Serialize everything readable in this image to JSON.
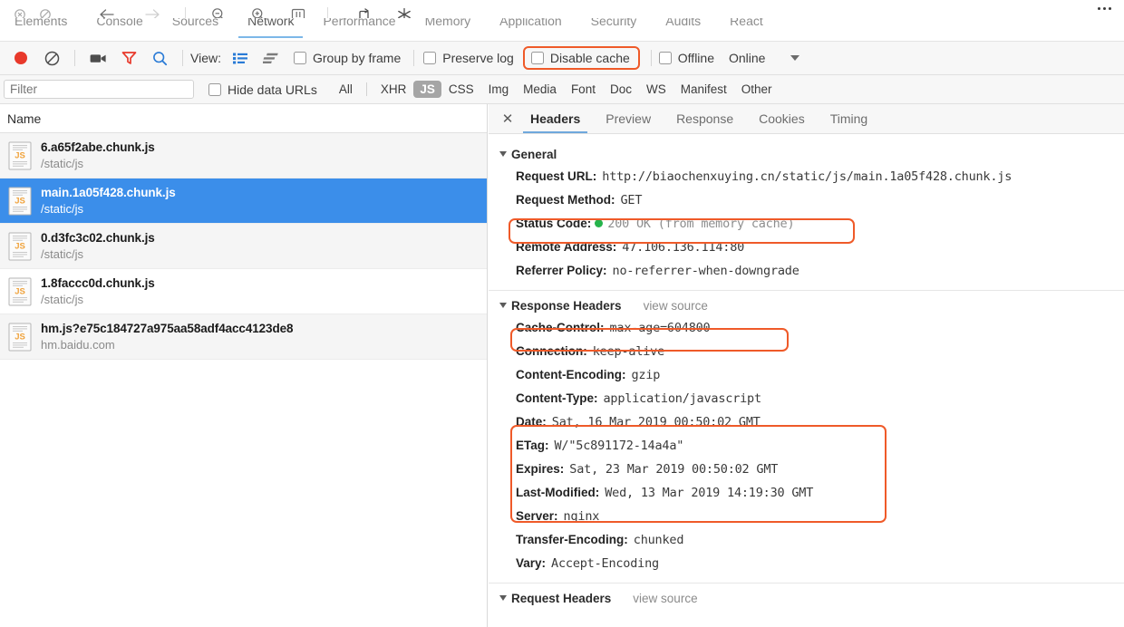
{
  "window": {
    "nav_back_icon": "arrow-left-icon",
    "nav_forward_icon": "arrow-right-icon",
    "zoom_out_icon": "zoom-out-icon",
    "zoom_in_icon": "zoom-in-icon",
    "layout_icon": "layout-icon",
    "reload_icon": "reload-icon",
    "magic_icon": "magic-wand-icon",
    "overflow_icon": "more-options-icon"
  },
  "panel_tabs": [
    {
      "label": "Elements",
      "selected": false
    },
    {
      "label": "Console",
      "selected": false
    },
    {
      "label": "Sources",
      "selected": false
    },
    {
      "label": "Network",
      "selected": true
    },
    {
      "label": "Performance",
      "selected": false
    },
    {
      "label": "Memory",
      "selected": false
    },
    {
      "label": "Application",
      "selected": false
    },
    {
      "label": "Security",
      "selected": false
    },
    {
      "label": "Audits",
      "selected": false
    },
    {
      "label": "React",
      "selected": false
    }
  ],
  "network_toolbar": {
    "record_icon": "record-button-icon",
    "clear_icon": "clear-icon",
    "camera_icon": "capture-screenshots-icon",
    "filter_icon": "filter-icon",
    "search_icon": "search-icon",
    "view_label": "View:",
    "view_list_icon": "list-view-icon",
    "view_waterfall_icon": "waterfall-view-icon",
    "group_by_frame": "Group by frame",
    "preserve_log": "Preserve log",
    "disable_cache": "Disable cache",
    "offline": "Offline",
    "online": "Online",
    "throttle_caret_icon": "chevron-down-icon",
    "highlight_color": "#ef5a29"
  },
  "filter_bar": {
    "filter_placeholder": "Filter",
    "filter_value": "",
    "hide_data_urls": "Hide data URLs",
    "types": [
      {
        "label": "All",
        "active": false
      },
      {
        "label": "XHR",
        "active": false
      },
      {
        "label": "JS",
        "active": true
      },
      {
        "label": "CSS",
        "active": false
      },
      {
        "label": "Img",
        "active": false
      },
      {
        "label": "Media",
        "active": false
      },
      {
        "label": "Font",
        "active": false
      },
      {
        "label": "Doc",
        "active": false
      },
      {
        "label": "WS",
        "active": false
      },
      {
        "label": "Manifest",
        "active": false
      },
      {
        "label": "Other",
        "active": false
      }
    ]
  },
  "request_list": {
    "column_header": "Name",
    "rows": [
      {
        "name": "6.a65f2abe.chunk.js",
        "sub": "/static/js",
        "icon": "js-file-icon",
        "selected": false
      },
      {
        "name": "main.1a05f428.chunk.js",
        "sub": "/static/js",
        "icon": "js-file-icon",
        "selected": true
      },
      {
        "name": "0.d3fc3c02.chunk.js",
        "sub": "/static/js",
        "icon": "js-file-icon",
        "selected": false
      },
      {
        "name": "1.8faccc0d.chunk.js",
        "sub": "/static/js",
        "icon": "js-file-icon",
        "selected": false
      },
      {
        "name": "hm.js?e75c184727a975aa58adf4acc4123de8",
        "sub": "hm.baidu.com",
        "icon": "js-file-icon",
        "selected": false
      }
    ]
  },
  "detail": {
    "close_icon": "close-icon",
    "tabs": [
      {
        "label": "Headers",
        "selected": true
      },
      {
        "label": "Preview",
        "selected": false
      },
      {
        "label": "Response",
        "selected": false
      },
      {
        "label": "Cookies",
        "selected": false
      },
      {
        "label": "Timing",
        "selected": false
      }
    ],
    "general": {
      "title": "General",
      "rows": [
        {
          "key": "Request URL:",
          "value": "http://biaochenxuying.cn/static/js/main.1a05f428.chunk.js",
          "dim": false
        },
        {
          "key": "Request Method:",
          "value": "GET",
          "dim": false
        },
        {
          "key": "Status Code:",
          "value": "200 OK (from memory cache)",
          "dim": true,
          "status_dot": "#26b34b",
          "highlighted": true
        },
        {
          "key": "Remote Address:",
          "value": "47.106.136.114:80",
          "dim": false
        },
        {
          "key": "Referrer Policy:",
          "value": "no-referrer-when-downgrade",
          "dim": false
        }
      ]
    },
    "response_headers": {
      "title": "Response Headers",
      "view_source": "view source",
      "rows": [
        {
          "key": "Cache-Control:",
          "value": "max-age=604800",
          "highlighted": true
        },
        {
          "key": "Connection:",
          "value": "keep-alive",
          "highlighted": false
        },
        {
          "key": "Content-Encoding:",
          "value": "gzip",
          "highlighted": false
        },
        {
          "key": "Content-Type:",
          "value": "application/javascript",
          "highlighted": false
        },
        {
          "key": "Date:",
          "value": "Sat, 16 Mar 2019 00:50:02 GMT",
          "highlighted": true
        },
        {
          "key": "ETag:",
          "value": "W/\"5c891172-14a4a\"",
          "highlighted": true
        },
        {
          "key": "Expires:",
          "value": "Sat, 23 Mar 2019 00:50:02 GMT",
          "highlighted": true
        },
        {
          "key": "Last-Modified:",
          "value": "Wed, 13 Mar 2019 14:19:30 GMT",
          "highlighted": true
        },
        {
          "key": "Server:",
          "value": "nginx",
          "highlighted": false
        },
        {
          "key": "Transfer-Encoding:",
          "value": "chunked",
          "highlighted": false
        },
        {
          "key": "Vary:",
          "value": "Accept-Encoding",
          "highlighted": false
        }
      ]
    },
    "request_headers": {
      "title": "Request Headers",
      "view_source": "view source"
    }
  }
}
